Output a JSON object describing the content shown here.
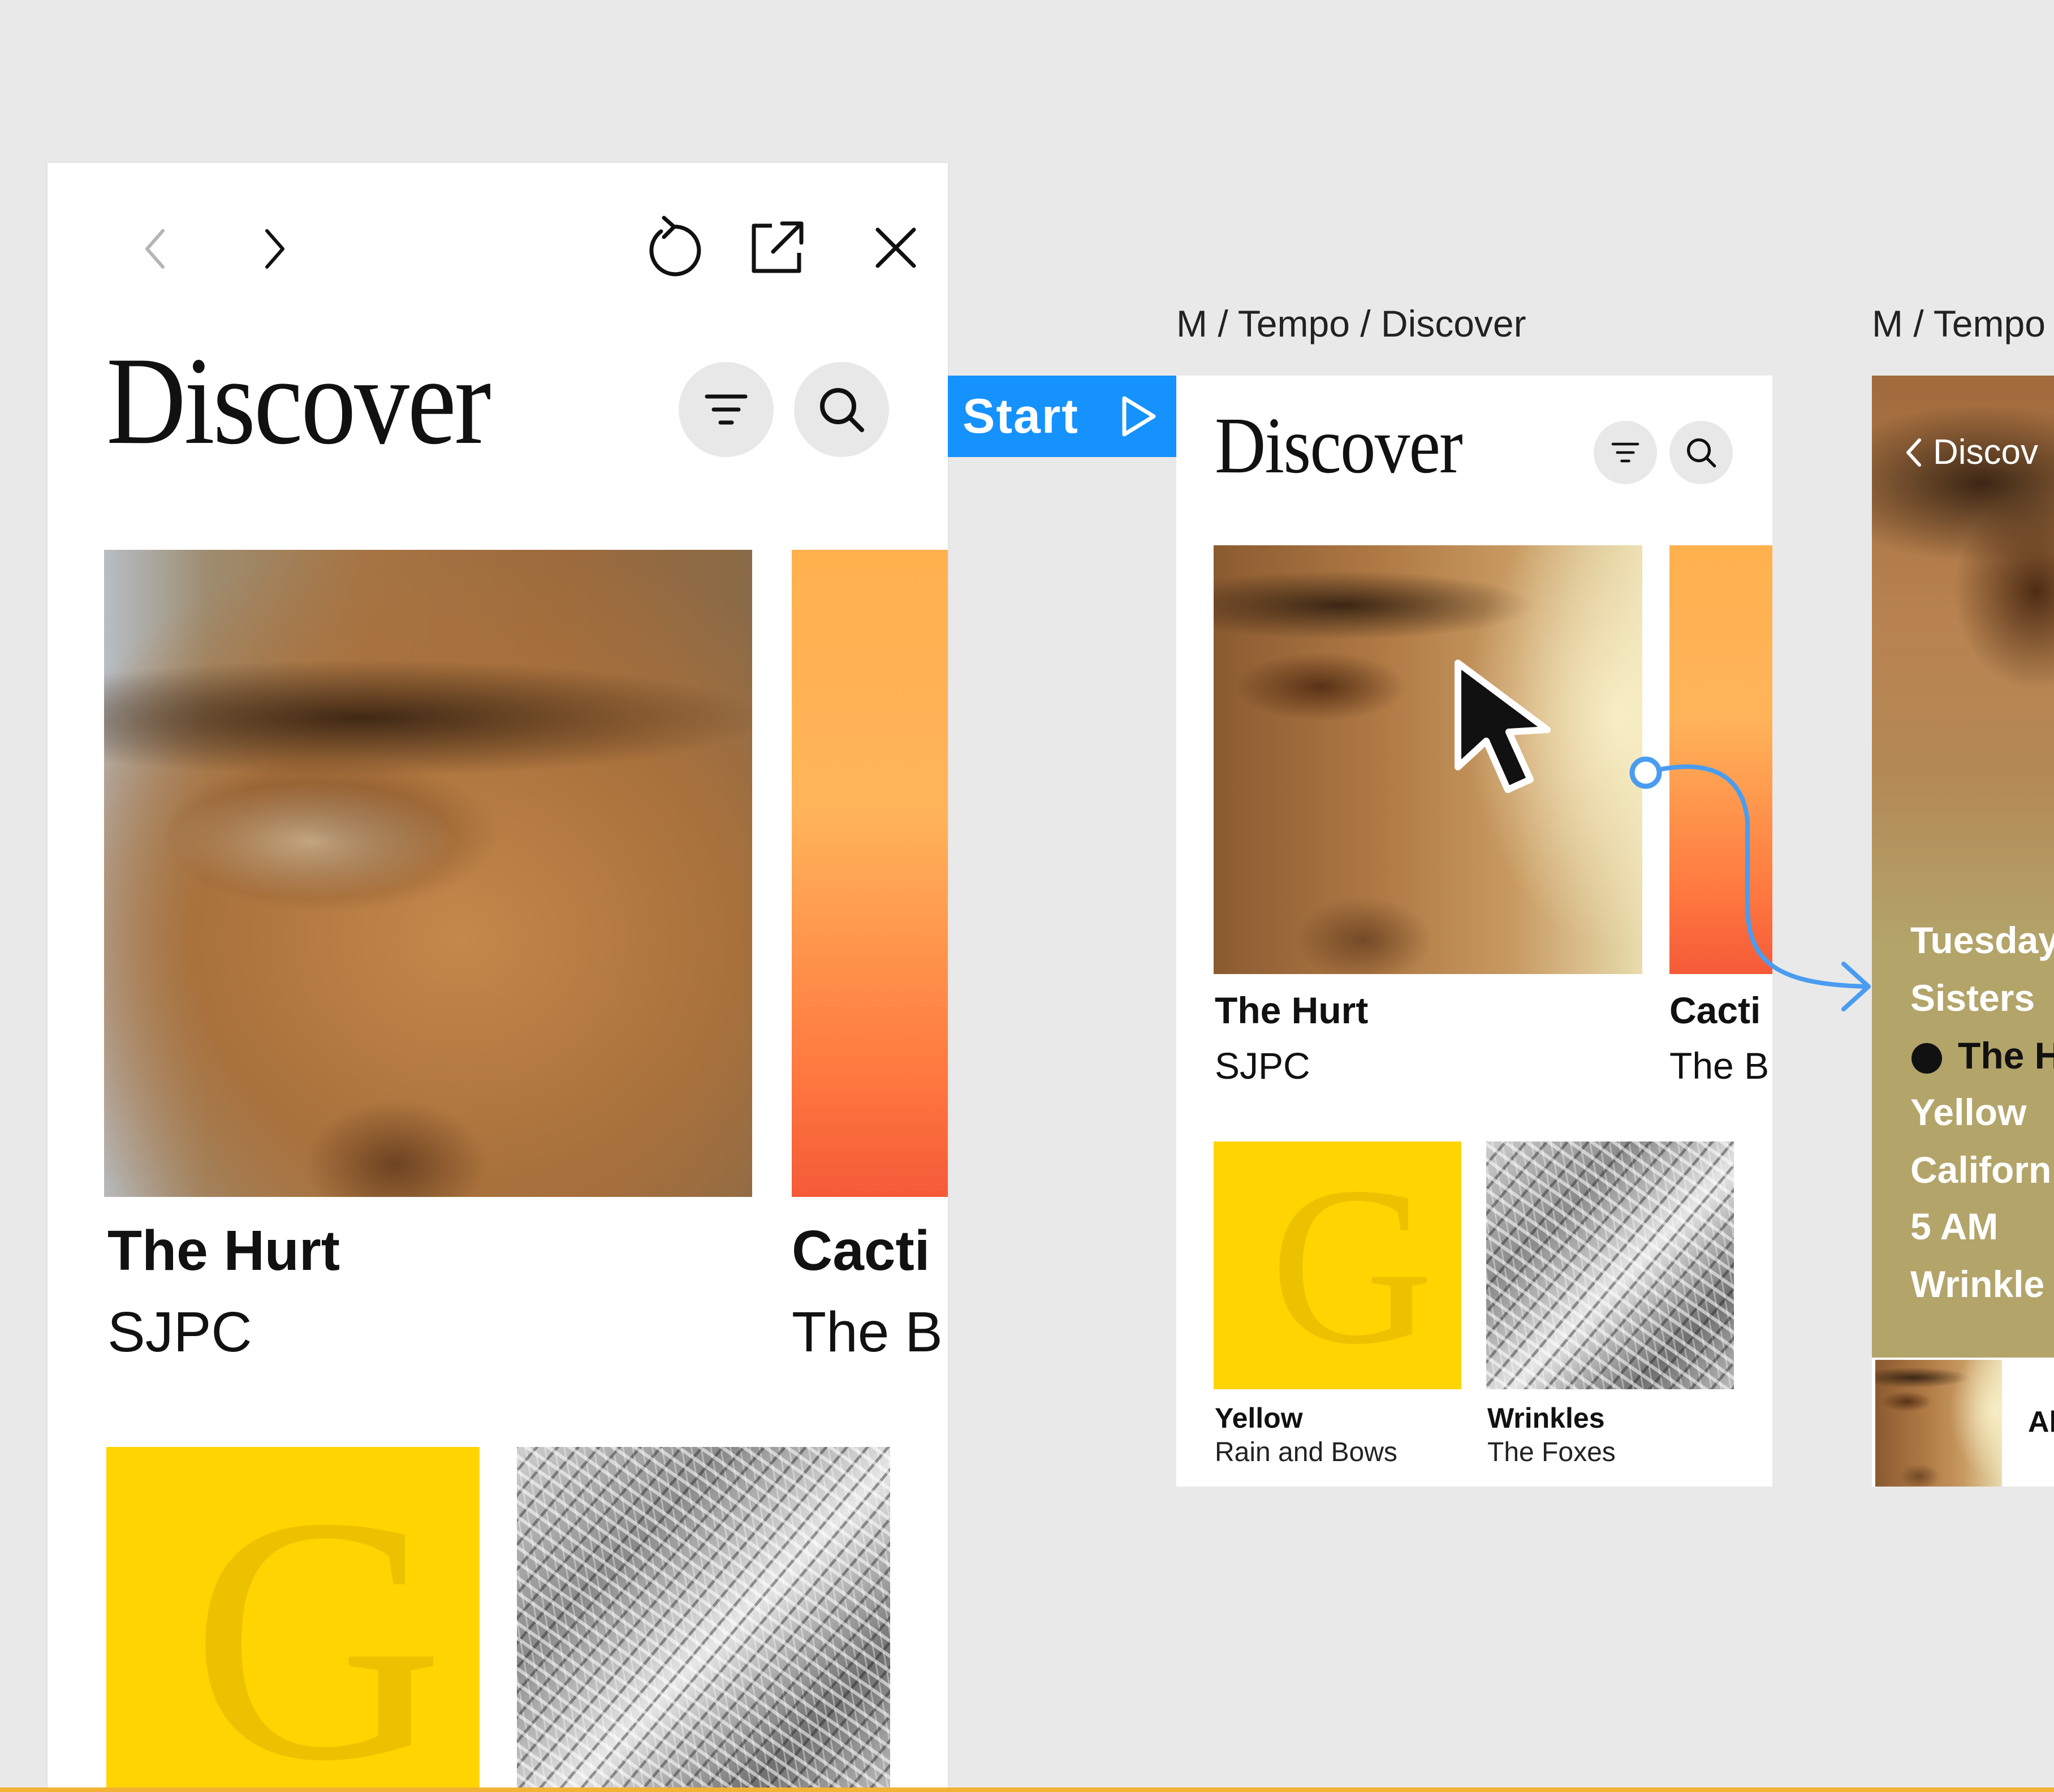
{
  "preview": {
    "toolbar": {
      "back_icon": "chevron-left-icon",
      "forward_icon": "chevron-right-icon",
      "restart_icon": "restart-icon",
      "open_external_icon": "open-external-icon",
      "close_icon": "close-icon"
    },
    "title": "Discover",
    "filter_icon": "filter-icon",
    "search_icon": "search-icon",
    "cards": [
      {
        "title": "The Hurt",
        "artist": "SJPC"
      },
      {
        "title": "Cacti",
        "artist": "The B"
      }
    ],
    "tiles": [
      {
        "letter": "G"
      },
      {
        "letter": ""
      }
    ]
  },
  "canvas": {
    "frame2_label": "M / Tempo / Discover",
    "frame3_label": "M / Tempo",
    "start_label": "Start",
    "start_icon": "play-triangle-icon",
    "frame2": {
      "title": "Discover",
      "cards": [
        {
          "title": "The Hurt",
          "artist": "SJPC"
        },
        {
          "title": "Cacti",
          "artist": "The B"
        }
      ],
      "tiles": [
        {
          "title": "Yellow",
          "artist": "Rain and Bows"
        },
        {
          "title": "Wrinkles",
          "artist": "The Foxes"
        }
      ]
    },
    "frame3": {
      "back_label": "Discov",
      "list": [
        "Tuesday",
        "Sisters",
        "The H",
        "Yellow",
        "Californ",
        "5 AM",
        "Wrinkle"
      ],
      "bottom_label": "Al"
    }
  },
  "colors": {
    "canvas_bg": "#e9e9e9",
    "start_blue": "#1592fd",
    "connector_blue": "#4a9cf0",
    "tile_yellow": "#ffd400",
    "olive": "#b3a46a"
  }
}
